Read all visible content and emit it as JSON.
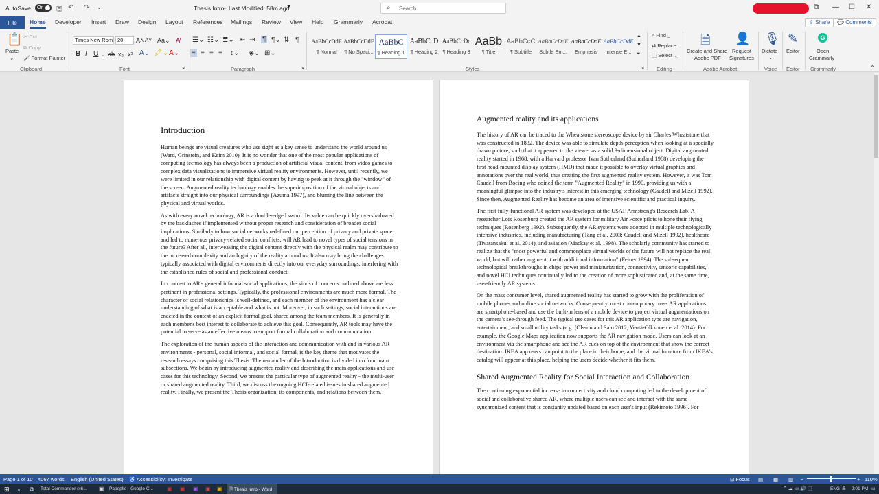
{
  "titlebar": {
    "autosave_label": "AutoSave",
    "autosave_state": "On",
    "doc_title": "Thesis Intro",
    "modified": "Last Modified: 58m ago",
    "search_placeholder": "Search",
    "minimize": "—",
    "maximize": "☐",
    "close": "✕"
  },
  "tabs": [
    "File",
    "Home",
    "Developer",
    "Insert",
    "Draw",
    "Design",
    "Layout",
    "References",
    "Mailings",
    "Review",
    "View",
    "Help",
    "Grammarly",
    "Acrobat"
  ],
  "top_buttons": {
    "share": "Share",
    "comments": "Comments"
  },
  "clipboard": {
    "paste": "Paste",
    "cut": "Cut",
    "copy": "Copy",
    "format_painter": "Format Painter",
    "label": "Clipboard"
  },
  "font": {
    "name": "Times New Roman",
    "size": "20",
    "label": "Font"
  },
  "paragraph": {
    "label": "Paragraph"
  },
  "styles": {
    "label": "Styles",
    "items": [
      {
        "sample": "AaBbCcDdE",
        "name": "¶ Normal"
      },
      {
        "sample": "AaBbCcDdE",
        "name": "¶ No Spaci..."
      },
      {
        "sample": "AaBbC",
        "name": "¶ Heading 1"
      },
      {
        "sample": "AaBbCcD",
        "name": "¶ Heading 2"
      },
      {
        "sample": "AaBbCcDc",
        "name": "¶ Heading 3"
      },
      {
        "sample": "AaBb",
        "name": "¶ Title"
      },
      {
        "sample": "AaBbCcC",
        "name": "¶ Subtitle"
      },
      {
        "sample": "AaBbCcDdE",
        "name": "Subtle Em..."
      },
      {
        "sample": "AaBbCcDdE",
        "name": "Emphasis"
      },
      {
        "sample": "AaBbCcDdE",
        "name": "Intense E..."
      }
    ]
  },
  "editing": {
    "find": "Find",
    "replace": "Replace",
    "select": "Select",
    "label": "Editing"
  },
  "acrobat": {
    "create": "Create and Share",
    "create2": "Adobe PDF",
    "request": "Request",
    "request2": "Signatures",
    "label": "Adobe Acrobat"
  },
  "voice": {
    "dictate": "Dictate",
    "label": "Voice"
  },
  "editor": {
    "editor": "Editor",
    "label": "Editor"
  },
  "grammarly": {
    "open": "Open",
    "open2": "Grammarly",
    "label": "Grammarly"
  },
  "page1": {
    "heading": "Introduction",
    "paragraphs": [
      "Human beings are visual creatures who use sight as a key sense to understand the world around us (Ward, Grinstein, and Keim 2010). It is no wonder that one of the most popular applications of computing technology has always been a production of artificial visual content, from video games to complex data visualizations to immersive virtual reality environments. However, until recently, we were limited in our relationship with digital content by having to peek at it through the \"window\" of the screen. Augmented reality technology enables the superimposition of the virtual objects and artifacts straight into our physical surroundings (Azuma 1997), and blurring the line between the physical and virtual worlds.",
      "As with every novel technology, AR is a double-edged sword. Its value can be quickly overshadowed by the backlashes if implemented without proper research and consideration of broader social implications. Similarly to how social networks redefined our perception of privacy and private space and led to numerous privacy-related social conflicts, will AR lead to novel types of social tensions in the future? After all, interweaving the digital content directly with the physical realm may contribute to the increased complexity and ambiguity of the reality around us. It also may bring the challenges typically associated with digital environments directly into our everyday surroundings, interfering with the established rules of social and professional conduct.",
      "In contrast to AR's general informal social applications, the kinds of concerns outlined above are less pertinent in professional settings.  Typically, the professional environments are much more formal. The character of social relationships is well-defined, and each member of the environment has a clear understanding of what is acceptable and what is not. Moreover, in such settings, social interactions are enacted in the context of an explicit formal goal, shared among the team members. It is generally in each member's best interest to collaborate to achieve this goal. Consequently, AR tools may have the potential to serve as an effective means to support formal collaboration and communication.",
      "The exploration of the human aspects of the interaction and communication with and in various AR environments - personal, social informal, and social formal, is the key theme that motivates the research essays comprising this Thesis. The remainder of the Introduction is divided into four main subsections. We begin by introducing augmented reality and describing the main applications and use cases for this technology. Second, we present the particular type of augmented reality - the multi-user or shared augmented reality. Third, we discuss the ongoing HCI-related issues in shared augmented reality. Finally, we present the Thesis organization, its components, and relations between them."
    ]
  },
  "page2": {
    "heading": "Augmented reality and its applications",
    "paragraphs": [
      "The history of AR can be traced to the Wheatstone stereoscope device by sir Charles Wheatstone that was constructed in 1832. The device was able to simulate depth-perception when looking at a specially drawn picture, such that it appeared to the viewer as a solid 3-dimensional object. Digital augmented reality started in 1968, with a Harvard professor Ivan Sutherland (Sutherland 1968) developing the first head-mounted display system (HMD) that made it possible to overlay virtual graphics and annotations over the real world, thus creating the first augmented reality system. However, it was Tom Caudell from Boeing who coined the term \"Augmented Reality\" in 1990, providing us with a meaningful glimpse into the industry's interest in this emerging technology (Caudell and Mizell 1992). Since then, Augmented Reality has become an area of intensive scientific and practical inquiry.",
      "The first fully-functional AR system was developed at the USAF Armstrong's Research Lab. A researcher Lois Rosenburg created the AR system for military Air Force pilots to hone their flying techniques (Rosenberg 1992). Subsequently, the AR systems were adopted in multiple technologically intensive industries, including manufacturing (Tang et al. 2003; Caudell and Mizell 1992), healthcare (Tivatansakul et al. 2014), and aviation (Mackay et al. 1998). The scholarly community has started to realize that the \"most powerful and commonplace virtual worlds of the future will not replace the real world, but will rather augment it with additional information\" (Feiner 1994). The subsequent technological breakthroughs in chips' power and miniaturization, connectivity, sensoric capabilities, and novel HCI techniques continually led to the creation of more sophisticated and, at the same time, user-friendly AR systems.",
      "On the mass consumer level, shared augmented reality has started to grow with the proliferation of mobile phones and online social networks. Consequently, most contemporary mass AR applications are smartphone-based and use the built-in lens of a mobile device to project virtual augmentations on the camera's see-through feed. The typical use cases for this AR application type are navigation, entertainment, and small utility tasks (e.g. (Olsson and Salo 2012; Ventä-Olkkonen et al. 2014). For example, the Google Maps application now supports the AR navigation mode. Users can look at an environment via the smartphone and see the AR cues on top of the environment that show the correct destination. IKEA app users can point to the place in their home, and the virtual furniture from IKEA's catalog will appear at this place, helping the users decide whether it fits them."
    ],
    "heading2": "Shared Augmented Reality for Social Interaction and Collaboration",
    "paragraphs2": [
      "The continuing exponential increase in connectivity and cloud computing led to the development of social and collaborative shared AR, where multiple users can see and interact with the same synchronized content that is constantly updated based on each user's input (Rekimoto 1996). For"
    ]
  },
  "statusbar": {
    "page": "Page 1 of 10",
    "words": "4067 words",
    "language": "English (United States)",
    "accessibility": "Accessibility: Investigate",
    "focus": "Focus",
    "zoom": "110%"
  },
  "taskbar": {
    "item1": "Total Commander (x6...",
    "item2": "Papeplie - Google C...",
    "item3": "Thesis Intro - Word",
    "lang": "ENG",
    "time": "2:01 PM"
  },
  "colors": {
    "accent": "#2b579a",
    "redaction": "#e8112d"
  }
}
